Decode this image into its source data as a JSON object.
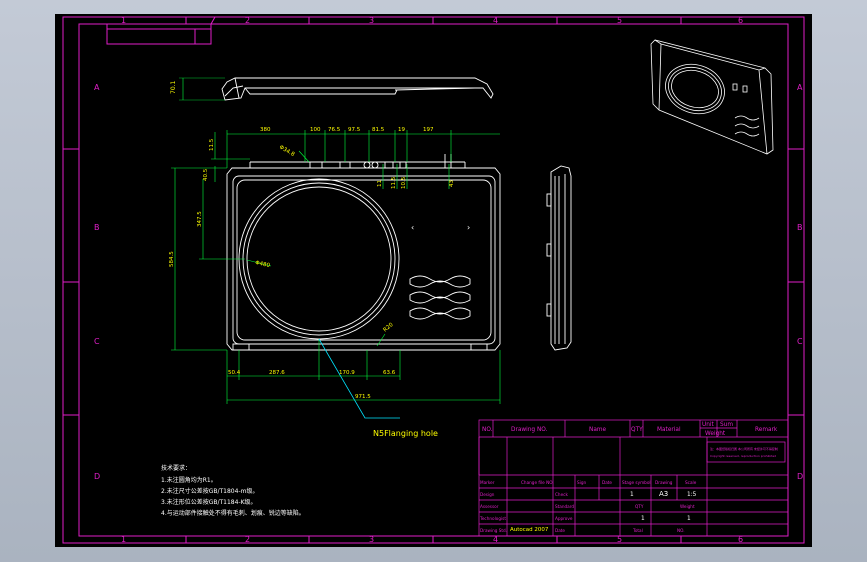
{
  "frame": {
    "zone_numbers_top": [
      "1",
      "2",
      "3",
      "4",
      "5",
      "6"
    ],
    "zone_numbers_bottom": [
      "1",
      "2",
      "3",
      "4",
      "5",
      "6"
    ],
    "zone_letters_left": [
      "A",
      "B",
      "C",
      "D"
    ],
    "zone_letters_right": [
      "A",
      "B",
      "C",
      "D"
    ]
  },
  "dimensions": {
    "top_row": [
      "380",
      "100",
      "76.5",
      "97.5",
      "81.5",
      "19",
      "197"
    ],
    "d1": "11.5",
    "d2": "40.5",
    "d3": "347.5",
    "d4": "584.5",
    "d5": "70.1",
    "bottom_row": [
      "50.4",
      "287.6",
      "170.9",
      "63.6"
    ],
    "overall": "971.5",
    "vert_small": [
      "11",
      "11.5",
      "10.5",
      "43"
    ],
    "diameter": "Φ480",
    "angle": "Φ34.8",
    "slot": "R20"
  },
  "callout": "N5Flanging hole",
  "notes": {
    "heading": "技术要求：",
    "lines": [
      "1.未注圆角均为R1。",
      "2.未注尺寸公差按GB/T1804-m级。",
      "3.未注形位公差按GB/T1184-K级。",
      "4.与运动部件接触处不得有毛刺、划痕、锐边等缺陷。"
    ]
  },
  "title_block": {
    "header": {
      "no": "NO.",
      "drawing_no": "Drawing NO.",
      "name": "Name",
      "qty": "QTY",
      "material": "Material",
      "unit": "Unit",
      "sum": "Sum",
      "weight": "Weight",
      "remark": "Remark"
    },
    "row_labels": [
      "Marker",
      "Design",
      "Assessor",
      "Technologist",
      "Drawing Std."
    ],
    "mid_labels": [
      "Change file NO.",
      "Check",
      "Standard",
      "Approve",
      "Date"
    ],
    "sign": "Sign",
    "date_col": "Date",
    "stage": "Stage symbol",
    "drawing": "Drawing",
    "scale": "Scale",
    "qty_val": "1",
    "sheet_size": "A3",
    "scale_val": "1:5",
    "qty2": "QTY",
    "weight2": "Weight",
    "count_a": "1",
    "count_b": "1",
    "total": "Total",
    "no2": "NO.",
    "software": "Autocad 2007",
    "tiny_note_1": "注：本图纸版权归属 本公司所有 未经许可不得复制",
    "tiny_note_2": "Copyright reserved, reproduction prohibited"
  },
  "colors": {
    "magenta": "#e01ec8",
    "white": "#ffffff",
    "green": "#00ff3c",
    "yellow": "#ffff00",
    "cyan": "#00e5ff",
    "red": "#ff2b2b"
  }
}
